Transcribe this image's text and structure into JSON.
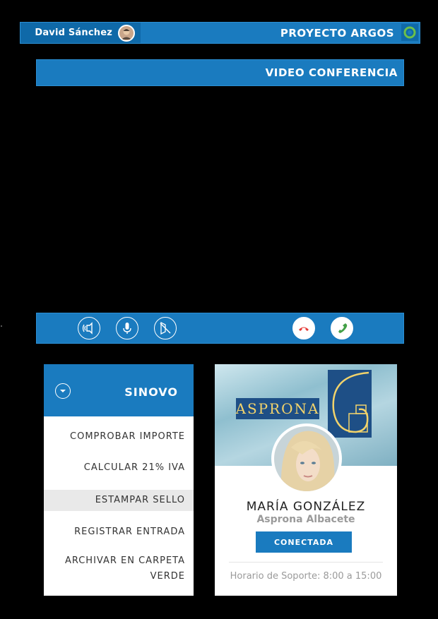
{
  "header": {
    "user_name": "David Sánchez",
    "project_title": "PROYECTO ARGOS"
  },
  "video_section": {
    "title": "VIDEO CONFERENCIA"
  },
  "call_controls": {
    "buttons": [
      {
        "icon": "speaker-icon"
      },
      {
        "icon": "microphone-icon"
      },
      {
        "icon": "video-off-icon"
      },
      {
        "icon": "hang-up-icon",
        "color": "#e53935"
      },
      {
        "icon": "answer-call-icon",
        "color": "#43a047"
      }
    ]
  },
  "menu": {
    "title": "SINOVO",
    "items": [
      {
        "label": "COMPROBAR IMPORTE"
      },
      {
        "label": "CALCULAR 21% IVA"
      },
      {
        "label": "ESTAMPAR SELLO",
        "active": true
      },
      {
        "label": "REGISTRAR ENTRADA"
      },
      {
        "label": "ARCHIVAR EN CARPETA VERDE"
      }
    ]
  },
  "contact": {
    "logo_text": "ASPRONA",
    "name": "MARÍA GONZÁLEZ",
    "company": "Asprona Albacete",
    "status_button": "CONECTADA",
    "hours": "Horario de Soporte: 8:00 a 15:00"
  },
  "colors": {
    "primary": "#1a7bbf",
    "primary_dark": "#0f69a8",
    "background": "#000000",
    "hang_up": "#e53935",
    "answer": "#43a047"
  }
}
